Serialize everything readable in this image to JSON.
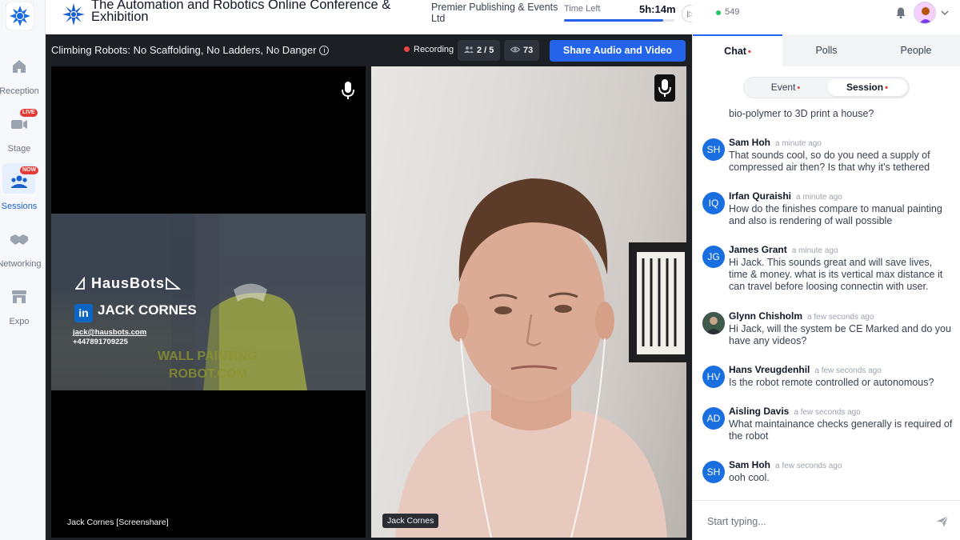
{
  "nav": {
    "items": [
      {
        "label": "Reception",
        "icon": "home-icon",
        "badge": ""
      },
      {
        "label": "Stage",
        "icon": "video-camera-icon",
        "badge": "LIVE"
      },
      {
        "label": "Sessions",
        "icon": "people-icon",
        "badge": "NOW"
      },
      {
        "label": "Networking",
        "icon": "handshake-icon",
        "badge": ""
      },
      {
        "label": "Expo",
        "icon": "booth-icon",
        "badge": ""
      }
    ]
  },
  "header": {
    "event_title": "The Automation and Robotics Online Conference & Exhibition",
    "organizer": "Premier Publishing & Events Ltd",
    "time_left_label": "Time Left",
    "time_left_value": "5h:14m",
    "time_progress": 0.9,
    "online_count": "549"
  },
  "stage": {
    "session_title": "Climbing Robots: No Scaffolding, No Ladders, No Danger",
    "recording_label": "Recording",
    "speakers_count": "2 / 5",
    "viewers_count": "73",
    "share_button": "Share Audio and Video",
    "tiles": [
      {
        "name": "Jack Cornes [Screenshare]"
      },
      {
        "name": "Jack Cornes"
      }
    ],
    "slide": {
      "logo_text": "HausBots",
      "presenter": "JACK CORNES",
      "email": "jack@hausbots.com",
      "phone": "+447891709225",
      "vest_line1": "WALL PAINTING",
      "vest_line2": "ROBOT.COM"
    }
  },
  "panel": {
    "tabs": [
      "Chat",
      "Polls",
      "People"
    ],
    "active_tab": "Chat",
    "segments": [
      "Event",
      "Session"
    ],
    "active_segment": "Session",
    "cut_off_text": "bio-polymer to 3D print a house?",
    "messages": [
      {
        "initials": "SH",
        "name": "Sam Hoh",
        "time": "a minute ago",
        "text": "That sounds cool, so do you need a supply of compressed air then? Is that why it's tethered"
      },
      {
        "initials": "IQ",
        "name": "Irfan Quraishi",
        "time": "a minute ago",
        "text": "How do the finishes compare to manual painting and also is rendering of wall possible"
      },
      {
        "initials": "JG",
        "name": "James Grant",
        "time": "a minute ago",
        "text": "Hi Jack. This sounds great and will save lives, time & money. what is its vertical max distance it can travel before loosing connectin with user."
      },
      {
        "initials": "",
        "name": "Glynn Chisholm",
        "time": "a few seconds ago",
        "text": "Hi Jack, will the system be CE Marked and do you have any videos?"
      },
      {
        "initials": "HV",
        "name": "Hans Vreugdenhil",
        "time": "a few seconds ago",
        "text": "Is the robot remote controlled or autonomous?"
      },
      {
        "initials": "AD",
        "name": "Aisling Davis",
        "time": "a few seconds ago",
        "text": "What maintainance checks generally is required of the robot"
      },
      {
        "initials": "SH",
        "name": "Sam Hoh",
        "time": "a few seconds ago",
        "text": "ooh cool."
      }
    ],
    "composer_placeholder": "Start typing..."
  },
  "colors": {
    "accent": "#2563eb",
    "live_badge": "#e53935",
    "stage_bg": "#1c1f24",
    "avatar": "#1a6fe0"
  }
}
